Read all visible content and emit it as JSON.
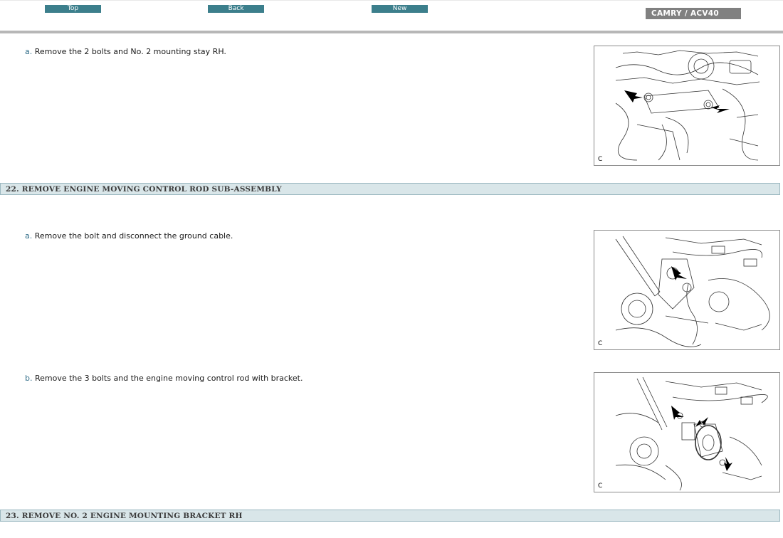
{
  "nav": {
    "top_label": "Top",
    "back_label": "Back",
    "new_label": "New",
    "model_label": "CAMRY / ACV40"
  },
  "steps": [
    {
      "letter": "a.",
      "text": "Remove the 2 bolts and No. 2 mounting stay RH.",
      "figure_label": "C"
    },
    {
      "letter": "a.",
      "text": "Remove the bolt and disconnect the ground cable.",
      "figure_label": "C"
    },
    {
      "letter": "b.",
      "text": "Remove the 3 bolts and the engine moving control rod with bracket.",
      "figure_label": "C"
    }
  ],
  "sections": [
    {
      "title": "22. REMOVE ENGINE MOVING CONTROL ROD SUB-ASSEMBLY"
    },
    {
      "title": "23. REMOVE NO. 2 ENGINE MOUNTING BRACKET RH"
    }
  ],
  "colors": {
    "nav_button": "#3c7f8c",
    "model_badge": "#808080",
    "section_bg": "#d9e6e9",
    "step_letter": "#336f8a"
  }
}
